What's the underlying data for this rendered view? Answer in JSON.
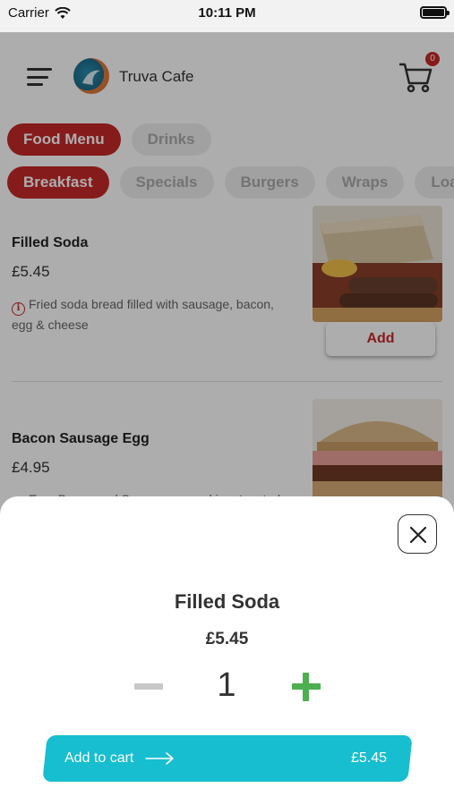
{
  "status_bar": {
    "carrier": "Carrier",
    "time": "10:11 PM"
  },
  "header": {
    "app_name": "Truva Cafe",
    "cart_count": "0"
  },
  "menu_tabs": [
    {
      "label": "Food Menu",
      "active": true
    },
    {
      "label": "Drinks",
      "active": false
    }
  ],
  "categories": [
    {
      "label": "Breakfast",
      "active": true
    },
    {
      "label": "Specials",
      "active": false
    },
    {
      "label": "Burgers",
      "active": false
    },
    {
      "label": "Wraps",
      "active": false
    },
    {
      "label": "Loa",
      "active": false
    }
  ],
  "items": [
    {
      "name": "Filled Soda",
      "price": "£5.45",
      "description": "Fried soda bread filled with sausage, bacon, egg & cheese",
      "add_label": "Add"
    },
    {
      "name": "Bacon Sausage Egg",
      "price": "£4.95",
      "description": "Egg, Bacon and Sausage served in a toasted"
    }
  ],
  "sheet": {
    "title": "Filled Soda",
    "price": "£5.45",
    "quantity": "1",
    "add_to_cart_label": "Add to cart",
    "total": "£5.45"
  },
  "colors": {
    "accent_red": "#c62828",
    "cart_button": "#17becf",
    "plus_green": "#4caf50"
  },
  "icons": [
    "wifi-icon",
    "battery-icon",
    "hamburger-menu-icon",
    "cafe-logo",
    "cart-icon",
    "info-icon",
    "close-icon",
    "minus-icon",
    "plus-icon",
    "arrow-right-icon"
  ]
}
